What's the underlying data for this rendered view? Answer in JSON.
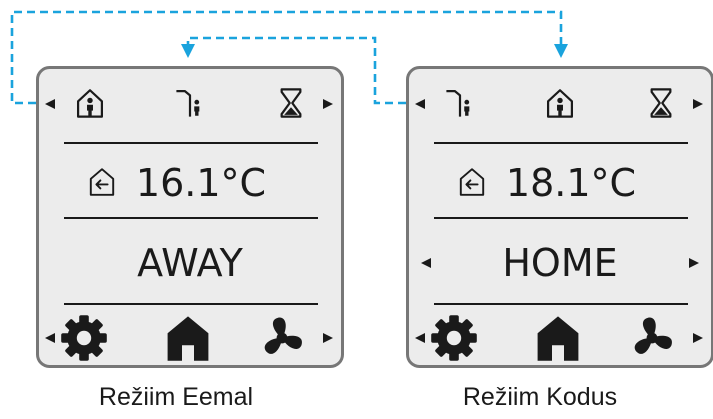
{
  "colors": {
    "flow_arrow": "#1aa3dd",
    "panel_border": "#777777",
    "panel_fill": "#ececec",
    "ink": "#1a1a1a"
  },
  "panels": [
    {
      "caption": "Režiim Eemal",
      "top_icons": [
        "home-icon",
        "door-exit-icon",
        "hourglass-icon"
      ],
      "temperature": "16.1°C",
      "temperature_icon": "supply-air-icon",
      "mode": "AWAY",
      "mode_arrows": false,
      "bottom_icons": [
        "gear-icon",
        "house-icon",
        "fan-icon"
      ]
    },
    {
      "caption": "Režiim Kodus",
      "top_icons": [
        "door-exit-icon",
        "home-icon",
        "hourglass-icon"
      ],
      "temperature": "18.1°C",
      "temperature_icon": "supply-air-icon",
      "mode": "HOME",
      "mode_arrows": true,
      "bottom_icons": [
        "gear-icon",
        "house-icon",
        "fan-icon"
      ]
    }
  ]
}
